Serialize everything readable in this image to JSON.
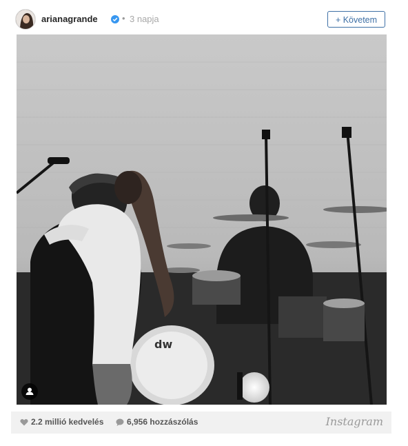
{
  "post": {
    "username": "arianagrande",
    "separator": "•",
    "time_ago": "3 napja",
    "follow_label": "+ Követem"
  },
  "footer": {
    "likes": "2.2 millió kedvelés",
    "comments": "6,956 hozzászólás",
    "brand": "Instagram"
  },
  "colors": {
    "follow_accent": "#3d6fa5",
    "verified_badge": "#3897f0",
    "footer_bg": "#f1f1f1"
  },
  "icons": [
    "verified-badge-icon",
    "user-tag-icon",
    "heart-icon",
    "comment-bubble-icon"
  ]
}
